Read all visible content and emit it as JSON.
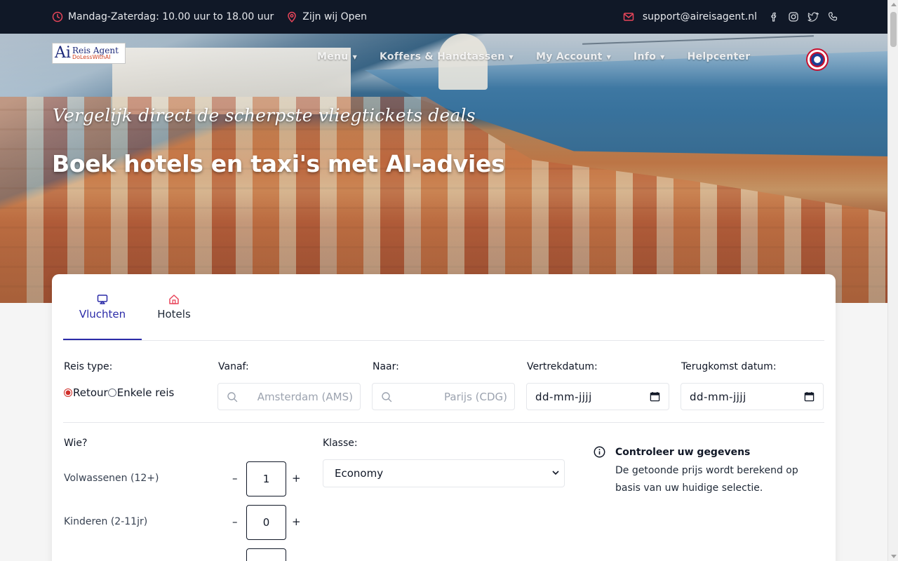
{
  "topbar": {
    "hours": "Mandag-Zaterdag: 10.00 uur to 18.00 uur",
    "open": "Zijn wij Open",
    "email": "support@aireisagent.nl",
    "icons": [
      "clock-icon",
      "location-icon",
      "mail-icon",
      "facebook-icon",
      "instagram-icon",
      "twitter-icon",
      "phone-icon"
    ],
    "accent": "#e8455a"
  },
  "logo": {
    "ai": "Ai",
    "name": "Reis Agent",
    "tagline": "DoLessWithAI"
  },
  "nav": {
    "items": [
      {
        "label": "Menu",
        "has_caret": true
      },
      {
        "label": "Koffers & Handtassen",
        "has_caret": true
      },
      {
        "label": "My Account",
        "has_caret": true
      },
      {
        "label": "Info",
        "has_caret": true
      },
      {
        "label": "Helpcenter",
        "has_caret": false
      }
    ]
  },
  "hero": {
    "subtitle": "Vergelijk direct de scherpste vliegtickets deals",
    "title": "Boek hotels en taxi's met AI-advies"
  },
  "search": {
    "tabs": [
      {
        "label": "Vluchten",
        "icon": "plane-screen-icon",
        "active": true
      },
      {
        "label": "Hotels",
        "icon": "home-icon",
        "active": false
      }
    ],
    "trip_type": {
      "label": "Reis type:",
      "options": [
        "Retour",
        "Enkele reis"
      ],
      "selected": "Retour"
    },
    "from": {
      "label": "Vanaf:",
      "placeholder": "Amsterdam (AMS)"
    },
    "to": {
      "label": "Naar:",
      "placeholder": "Parijs (CDG)"
    },
    "depart": {
      "label": "Vertrekdatum:",
      "value": "dd-mm-jjjj"
    },
    "return": {
      "label": "Terugkomst datum:",
      "value": "dd-mm-jjjj"
    },
    "who": {
      "label": "Wie?"
    },
    "adults": {
      "label": "Volwassenen (12+)",
      "value": "1",
      "minus": "–",
      "plus": "+"
    },
    "children": {
      "label": "Kinderen (2-11jr)",
      "value": "0",
      "minus": "–",
      "plus": "+"
    },
    "class": {
      "label": "Klasse:",
      "selected": "Economy"
    },
    "notice": {
      "title": "Controleer uw gegevens",
      "body": "De getoonde prijs wordt berekend op basis van uw huidige selectie."
    },
    "accent": "#2b2ba8"
  }
}
